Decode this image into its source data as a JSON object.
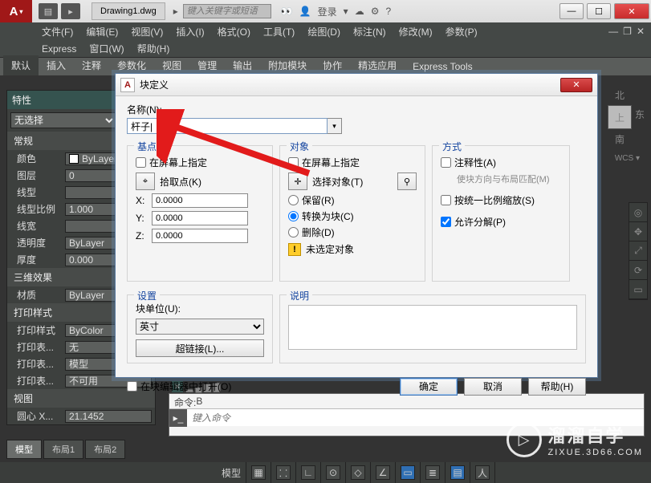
{
  "titlebar": {
    "app_logo": "A",
    "doc_tab": "Drawing1.dwg",
    "search_placeholder": "键入关键字或短语",
    "login_label": "登录"
  },
  "menu1": [
    "文件(F)",
    "编辑(E)",
    "视图(V)",
    "插入(I)",
    "格式(O)",
    "工具(T)",
    "绘图(D)",
    "标注(N)",
    "修改(M)",
    "参数(P)"
  ],
  "menu2": [
    "Express",
    "窗口(W)",
    "帮助(H)"
  ],
  "ribbon_tabs": [
    "默认",
    "插入",
    "注释",
    "参数化",
    "视图",
    "管理",
    "输出",
    "附加模块",
    "协作",
    "精选应用",
    "Express Tools"
  ],
  "prop": {
    "panel_title": "特性",
    "selection": "无选择",
    "groups": {
      "general": "常规",
      "general_rows": [
        {
          "label": "颜色",
          "value": "ByLayer"
        },
        {
          "label": "图层",
          "value": "0"
        },
        {
          "label": "线型",
          "value": ""
        },
        {
          "label": "线型比例",
          "value": "1.000"
        },
        {
          "label": "线宽",
          "value": ""
        },
        {
          "label": "透明度",
          "value": "ByLayer"
        },
        {
          "label": "厚度",
          "value": "0.000"
        }
      ],
      "threeD": "三维效果",
      "threeD_rows": [
        {
          "label": "材质",
          "value": "ByLayer"
        }
      ],
      "plot": "打印样式",
      "plot_rows": [
        {
          "label": "打印样式",
          "value": "ByColor"
        },
        {
          "label": "打印表...",
          "value": "无"
        },
        {
          "label": "打印表...",
          "value": "模型"
        },
        {
          "label": "打印表...",
          "value": "不可用"
        }
      ],
      "view": "视图",
      "view_rows": [
        {
          "label": "圆心 X...",
          "value": "21.1452"
        }
      ]
    }
  },
  "layout_tabs": [
    "模型",
    "布局1",
    "布局2"
  ],
  "cmd": {
    "history_prefix": "命令: ",
    "history_value": "B",
    "placeholder": "键入命令",
    "lock_row": "▂ ▄ ▆ ▇"
  },
  "navcube": {
    "north": "北",
    "east": "东",
    "south": "南",
    "face": "上",
    "wcs": "WCS ▾"
  },
  "dialog": {
    "title": "块定义",
    "name_label": "名称(N):",
    "name_value": "杆子|",
    "group_base": "基点",
    "base_onscreen": "在屏幕上指定",
    "base_pick": "拾取点(K)",
    "x_label": "X:",
    "y_label": "Y:",
    "z_label": "Z:",
    "x": "0.0000",
    "y_val": "0.0000",
    "z": "0.0000",
    "group_obj": "对象",
    "obj_onscreen": "在屏幕上指定",
    "obj_select": "选择对象(T)",
    "obj_keep": "保留(R)",
    "obj_convert": "转换为块(C)",
    "obj_delete": "删除(D)",
    "obj_none": "未选定对象",
    "group_mode": "方式",
    "mode_annot": "注释性(A)",
    "mode_match": "使块方向与布局匹配(M)",
    "mode_scale": "按统一比例缩放(S)",
    "mode_explode": "允许分解(P)",
    "group_set": "设置",
    "set_unit_label": "块单位(U):",
    "set_unit_value": "英寸",
    "set_link": "超链接(L)...",
    "group_desc": "说明",
    "open_editor": "在块编辑器中打开(O)",
    "ok": "确定",
    "cancel": "取消",
    "help": "帮助(H)"
  },
  "statusbar": {
    "model": "模型"
  },
  "watermark": {
    "brand": "溜溜自学",
    "url": "ZIXUE.3D66.COM"
  }
}
